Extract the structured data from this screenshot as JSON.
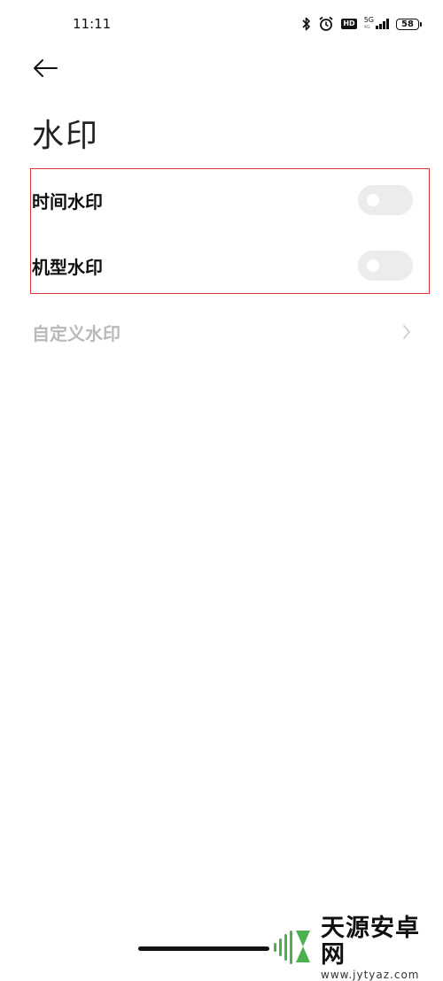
{
  "status_bar": {
    "time": "11:11",
    "network": "5G",
    "network_sub": "4G",
    "hd_badge": "HD",
    "battery": "58",
    "icons": [
      "bluetooth-icon",
      "alarm-icon",
      "hd-icon",
      "signal-icon",
      "battery-icon"
    ]
  },
  "header": {
    "back_icon": "arrow-left-icon",
    "title": "水印"
  },
  "settings": [
    {
      "label": "时间水印",
      "type": "toggle",
      "on": false
    },
    {
      "label": "机型水印",
      "type": "toggle",
      "on": false
    },
    {
      "label": "自定义水印",
      "type": "link",
      "enabled": false,
      "icon": "chevron-right-icon"
    }
  ],
  "colors": {
    "highlight_border": "#e0363a",
    "toggle_off": "#ececec",
    "disabled_text": "#b9b9b9",
    "watermark_green": "#4caf50"
  },
  "watermark": {
    "brand": "天源安卓网",
    "url": "www.jytyaz.com"
  }
}
